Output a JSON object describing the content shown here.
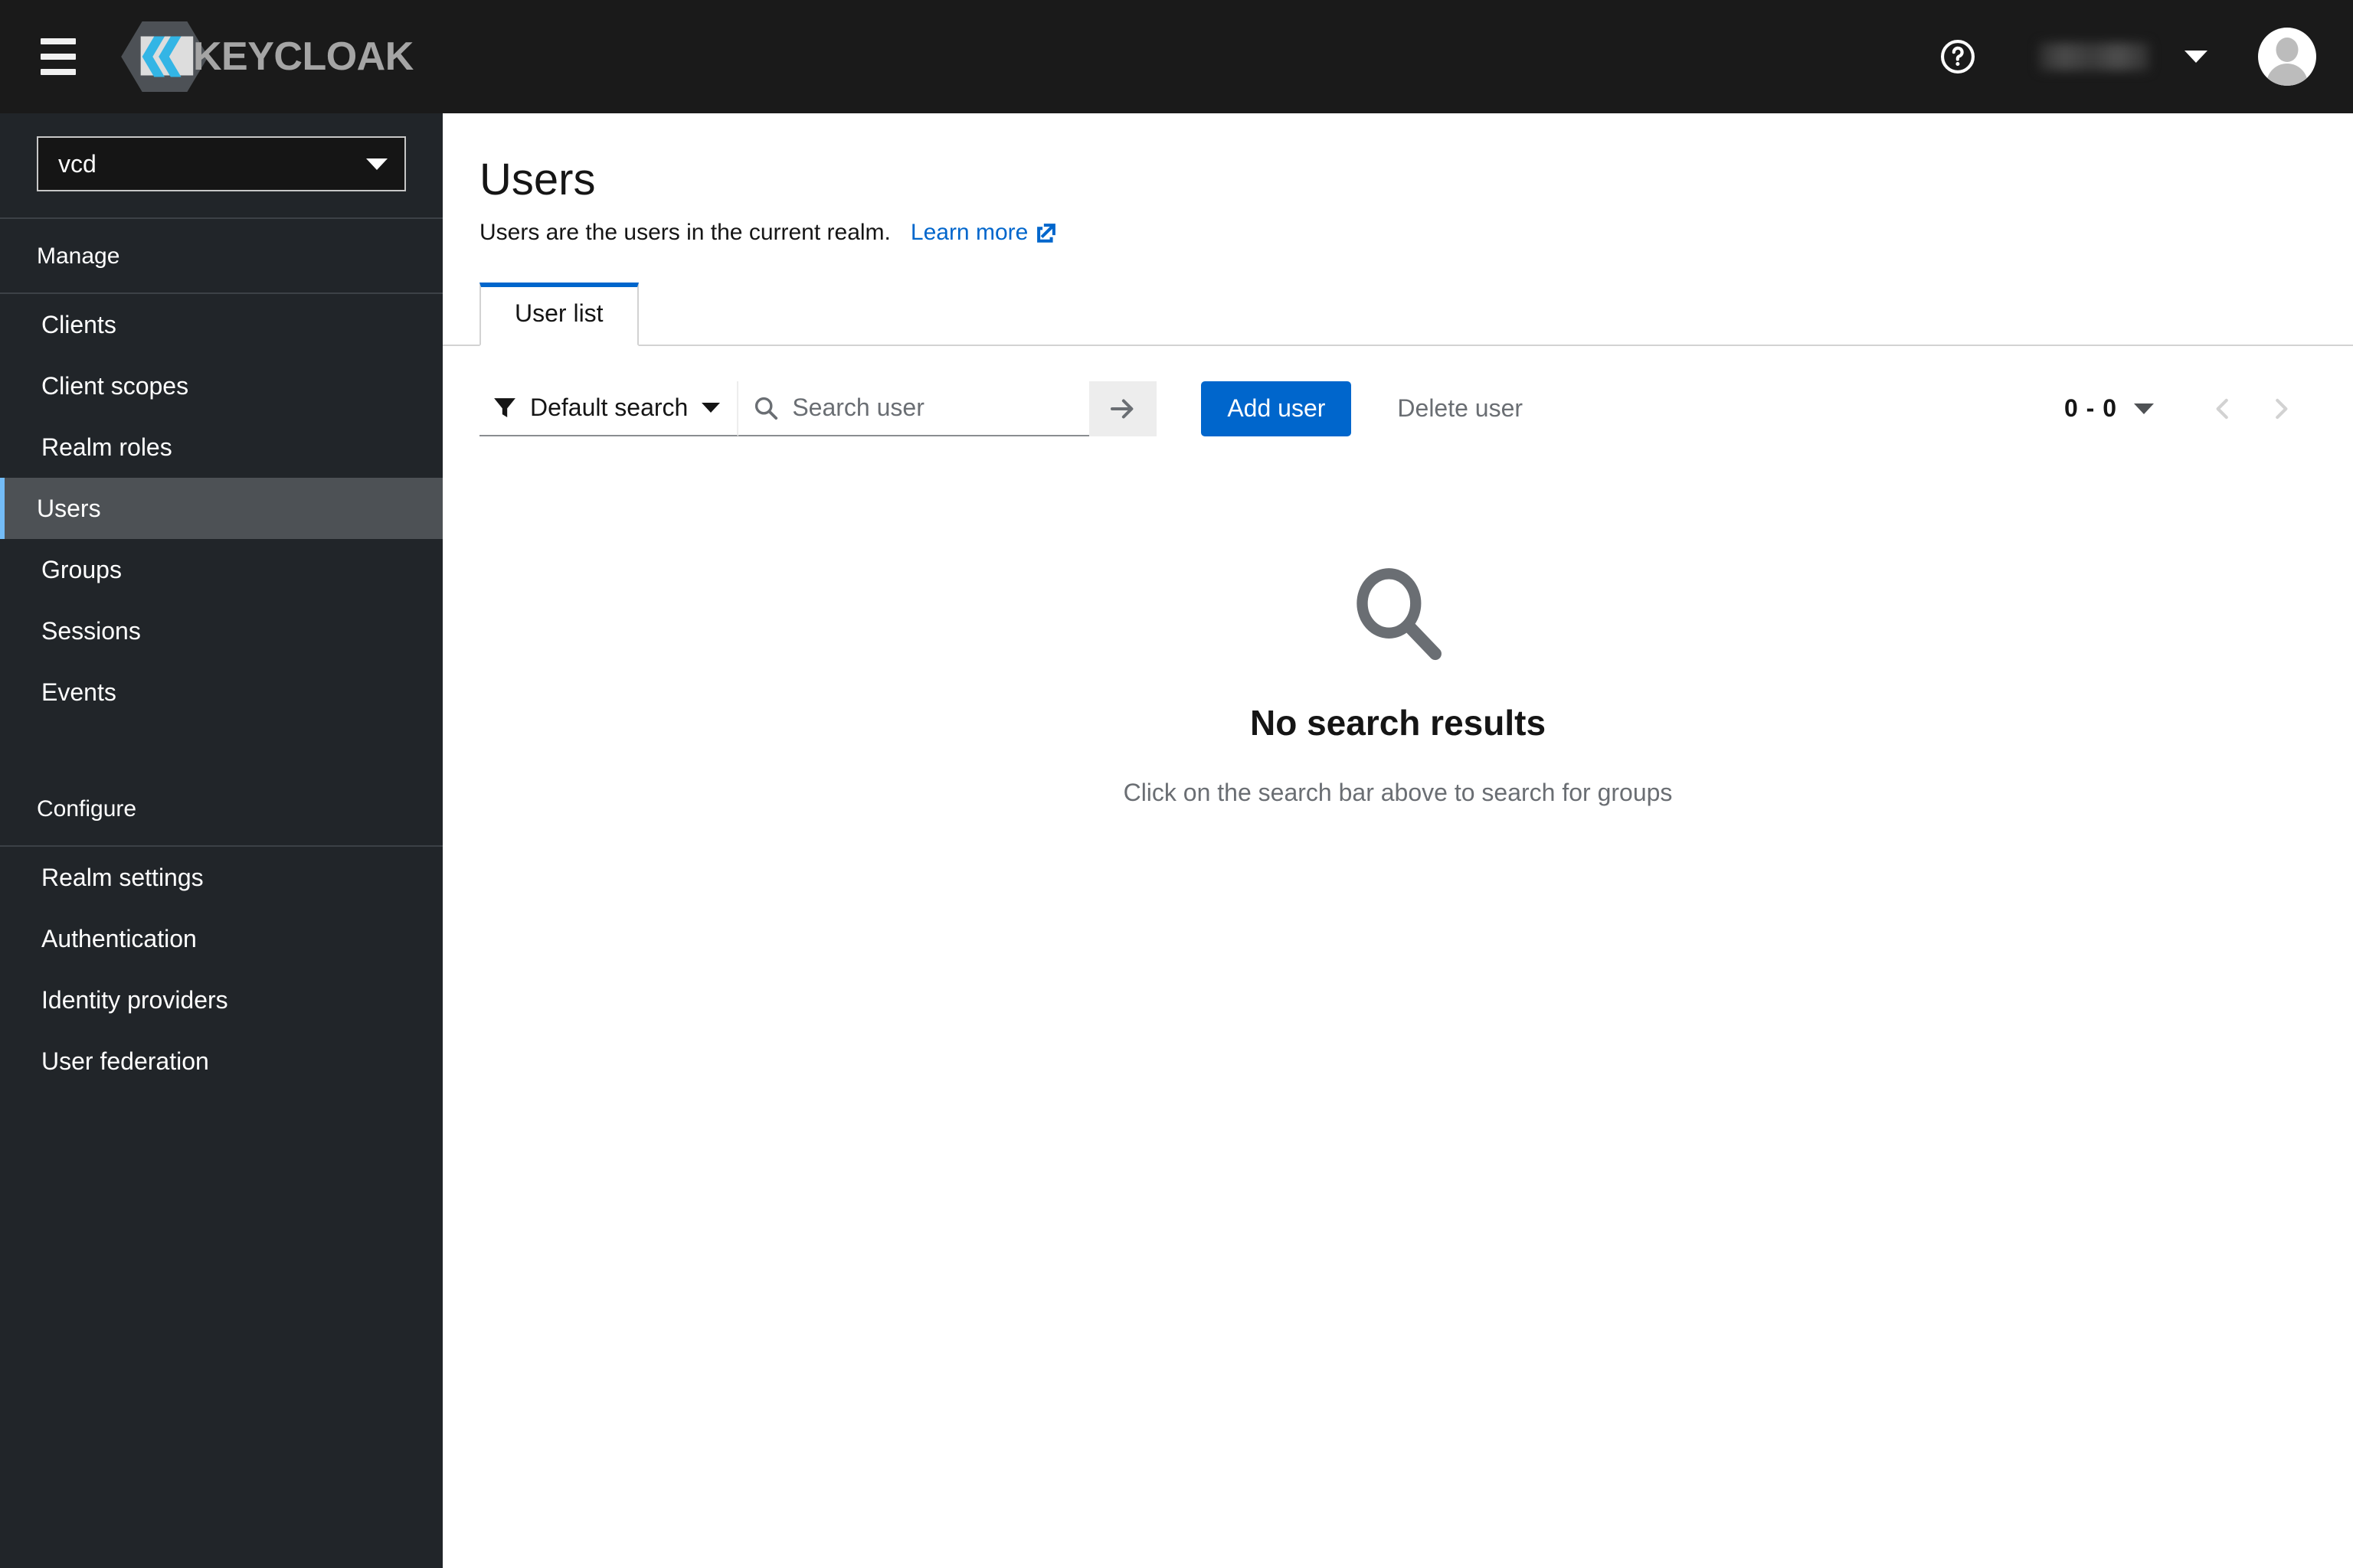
{
  "masthead": {
    "menu_toggle_label": "Global navigation",
    "brand_name": "KEYCLOAK",
    "help_label": "?",
    "user_name": "",
    "avatar_label": "User avatar"
  },
  "sidebar": {
    "realm_selector": {
      "value": "vcd"
    },
    "sections": [
      {
        "title": "Manage",
        "items": [
          {
            "label": "Clients",
            "active": false
          },
          {
            "label": "Client scopes",
            "active": false
          },
          {
            "label": "Realm roles",
            "active": false
          },
          {
            "label": "Users",
            "active": true
          },
          {
            "label": "Groups",
            "active": false
          },
          {
            "label": "Sessions",
            "active": false
          },
          {
            "label": "Events",
            "active": false
          }
        ]
      },
      {
        "title": "Configure",
        "items": [
          {
            "label": "Realm settings",
            "active": false
          },
          {
            "label": "Authentication",
            "active": false
          },
          {
            "label": "Identity providers",
            "active": false
          },
          {
            "label": "User federation",
            "active": false
          }
        ]
      }
    ]
  },
  "page": {
    "title": "Users",
    "subtitle": "Users are the users in the current realm.",
    "learn_more_label": "Learn more"
  },
  "tabs": [
    {
      "label": "User list",
      "active": true
    }
  ],
  "toolbar": {
    "filter_label": "Default search",
    "search_placeholder": "Search user",
    "search_value": "",
    "search_go_label": "Search",
    "add_user_label": "Add user",
    "delete_user_label": "Delete user"
  },
  "pagination": {
    "range_label": "0 - 0",
    "prev_label": "Previous page",
    "next_label": "Next page"
  },
  "empty_state": {
    "title": "No search results",
    "body": "Click on the search bar above to search for groups"
  },
  "colors": {
    "masthead_bg": "#1a1a1a",
    "sidebar_bg": "#212529",
    "sidebar_active_bg": "#4d5155",
    "sidebar_active_accent": "#73bcf7",
    "primary_blue": "#0066cc",
    "link_blue": "#0066cc",
    "muted_text": "#6a6e73",
    "brand_accent": "#33b5e5"
  }
}
